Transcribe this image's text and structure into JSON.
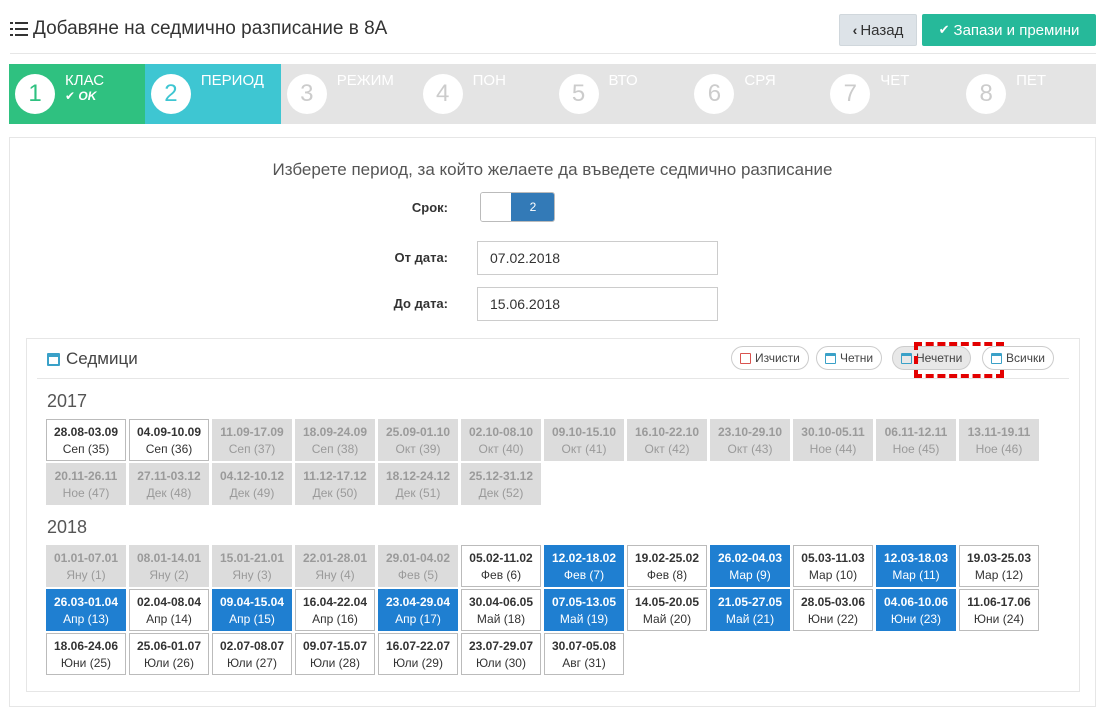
{
  "header": {
    "title": "Добавяне на седмично разписание в 8А",
    "back_label": "Назад",
    "save_label": "Запази и премини"
  },
  "wizard": {
    "steps": [
      {
        "num": "1",
        "label": "КЛАС",
        "status": "done",
        "sub": "OK"
      },
      {
        "num": "2",
        "label": "ПЕРИОД",
        "status": "active"
      },
      {
        "num": "3",
        "label": "РЕЖИМ",
        "status": "todo"
      },
      {
        "num": "4",
        "label": "ПОН",
        "status": "todo"
      },
      {
        "num": "5",
        "label": "ВТО",
        "status": "todo"
      },
      {
        "num": "6",
        "label": "СРЯ",
        "status": "todo"
      },
      {
        "num": "7",
        "label": "ЧЕТ",
        "status": "todo"
      },
      {
        "num": "8",
        "label": "ПЕТ",
        "status": "todo"
      }
    ]
  },
  "period": {
    "prompt": "Изберете период, за който желаете да въведете седмично разписание",
    "term_label": "Срок:",
    "term_value": "2",
    "from_label": "От дата:",
    "from_value": "07.02.2018",
    "to_label": "До дата:",
    "to_value": "15.06.2018"
  },
  "weeks": {
    "title": "Седмици",
    "buttons": {
      "clear": "Изчисти",
      "even": "Четни",
      "odd": "Нечетни",
      "all": "Всички"
    },
    "years": [
      {
        "year": "2017",
        "items": [
          {
            "d": "28.08-03.09",
            "m": "Сеп (35)",
            "s": "normal"
          },
          {
            "d": "04.09-10.09",
            "m": "Сеп (36)",
            "s": "normal"
          },
          {
            "d": "11.09-17.09",
            "m": "Сеп (37)",
            "s": "past"
          },
          {
            "d": "18.09-24.09",
            "m": "Сеп (38)",
            "s": "past"
          },
          {
            "d": "25.09-01.10",
            "m": "Окт (39)",
            "s": "past"
          },
          {
            "d": "02.10-08.10",
            "m": "Окт (40)",
            "s": "past"
          },
          {
            "d": "09.10-15.10",
            "m": "Окт (41)",
            "s": "past"
          },
          {
            "d": "16.10-22.10",
            "m": "Окт (42)",
            "s": "past"
          },
          {
            "d": "23.10-29.10",
            "m": "Окт (43)",
            "s": "past"
          },
          {
            "d": "30.10-05.11",
            "m": "Ное (44)",
            "s": "past"
          },
          {
            "d": "06.11-12.11",
            "m": "Ное (45)",
            "s": "past"
          },
          {
            "d": "13.11-19.11",
            "m": "Ное (46)",
            "s": "past"
          },
          {
            "d": "20.11-26.11",
            "m": "Ное (47)",
            "s": "past"
          },
          {
            "d": "27.11-03.12",
            "m": "Дек (48)",
            "s": "past"
          },
          {
            "d": "04.12-10.12",
            "m": "Дек (49)",
            "s": "past"
          },
          {
            "d": "11.12-17.12",
            "m": "Дек (50)",
            "s": "past"
          },
          {
            "d": "18.12-24.12",
            "m": "Дек (51)",
            "s": "past"
          },
          {
            "d": "25.12-31.12",
            "m": "Дек (52)",
            "s": "past"
          }
        ]
      },
      {
        "year": "2018",
        "items": [
          {
            "d": "01.01-07.01",
            "m": "Яну (1)",
            "s": "past"
          },
          {
            "d": "08.01-14.01",
            "m": "Яну (2)",
            "s": "past"
          },
          {
            "d": "15.01-21.01",
            "m": "Яну (3)",
            "s": "past"
          },
          {
            "d": "22.01-28.01",
            "m": "Яну (4)",
            "s": "past"
          },
          {
            "d": "29.01-04.02",
            "m": "Фев (5)",
            "s": "past"
          },
          {
            "d": "05.02-11.02",
            "m": "Фев (6)",
            "s": "normal"
          },
          {
            "d": "12.02-18.02",
            "m": "Фев (7)",
            "s": "sel"
          },
          {
            "d": "19.02-25.02",
            "m": "Фев (8)",
            "s": "normal"
          },
          {
            "d": "26.02-04.03",
            "m": "Мар (9)",
            "s": "sel"
          },
          {
            "d": "05.03-11.03",
            "m": "Мар (10)",
            "s": "normal"
          },
          {
            "d": "12.03-18.03",
            "m": "Мар (11)",
            "s": "sel"
          },
          {
            "d": "19.03-25.03",
            "m": "Мар (12)",
            "s": "normal"
          },
          {
            "d": "26.03-01.04",
            "m": "Апр (13)",
            "s": "sel"
          },
          {
            "d": "02.04-08.04",
            "m": "Апр (14)",
            "s": "normal"
          },
          {
            "d": "09.04-15.04",
            "m": "Апр (15)",
            "s": "sel"
          },
          {
            "d": "16.04-22.04",
            "m": "Апр (16)",
            "s": "normal"
          },
          {
            "d": "23.04-29.04",
            "m": "Апр (17)",
            "s": "sel"
          },
          {
            "d": "30.04-06.05",
            "m": "Май (18)",
            "s": "normal"
          },
          {
            "d": "07.05-13.05",
            "m": "Май (19)",
            "s": "sel"
          },
          {
            "d": "14.05-20.05",
            "m": "Май (20)",
            "s": "normal"
          },
          {
            "d": "21.05-27.05",
            "m": "Май (21)",
            "s": "sel"
          },
          {
            "d": "28.05-03.06",
            "m": "Юни (22)",
            "s": "normal"
          },
          {
            "d": "04.06-10.06",
            "m": "Юни (23)",
            "s": "sel"
          },
          {
            "d": "11.06-17.06",
            "m": "Юни (24)",
            "s": "normal"
          },
          {
            "d": "18.06-24.06",
            "m": "Юни (25)",
            "s": "normal"
          },
          {
            "d": "25.06-01.07",
            "m": "Юли (26)",
            "s": "normal"
          },
          {
            "d": "02.07-08.07",
            "m": "Юли (27)",
            "s": "normal"
          },
          {
            "d": "09.07-15.07",
            "m": "Юли (28)",
            "s": "normal"
          },
          {
            "d": "16.07-22.07",
            "m": "Юли (29)",
            "s": "normal"
          },
          {
            "d": "23.07-29.07",
            "m": "Юли (30)",
            "s": "normal"
          },
          {
            "d": "30.07-05.08",
            "m": "Авг (31)",
            "s": "normal"
          }
        ]
      }
    ]
  }
}
